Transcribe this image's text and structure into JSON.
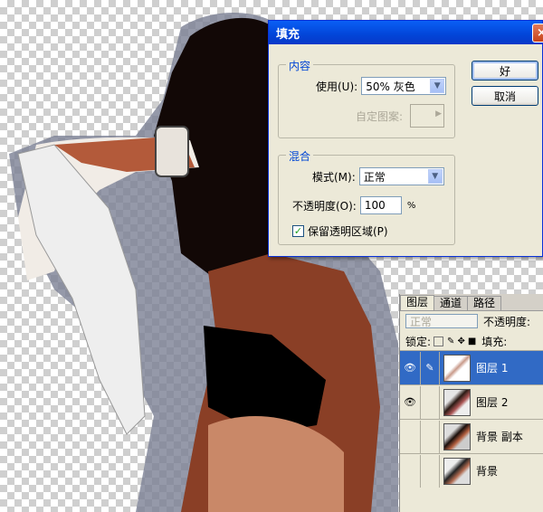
{
  "dialog": {
    "title": "填充",
    "close_glyph": "×",
    "content_group": "内容",
    "use_label": "使用(U):",
    "use_value": "50% 灰色",
    "pattern_label": "自定图案:",
    "blend_group": "混合",
    "mode_label": "模式(M):",
    "mode_value": "正常",
    "opacity_label": "不透明度(O):",
    "opacity_value": "100",
    "opacity_unit": "%",
    "preserve_label": "保留透明区域(P)",
    "preserve_checked": "✓",
    "ok_label": "好",
    "cancel_label": "取消"
  },
  "layers": {
    "tabs": [
      "图层",
      "通道",
      "路径"
    ],
    "blend_mode": "正常",
    "opacity_label": "不透明度:",
    "lock_label": "锁定:",
    "fill_label": "填充:",
    "items": [
      {
        "name": "图层 1",
        "visible": true,
        "selected": true
      },
      {
        "name": "图层 2",
        "visible": true,
        "selected": false
      },
      {
        "name": "背景 副本",
        "visible": false,
        "selected": false
      },
      {
        "name": "背景",
        "visible": false,
        "selected": false
      }
    ],
    "eye_glyph": "👁",
    "brush_glyph": "✎"
  },
  "colors": {
    "accent": "#316ac5",
    "titlebar": "#0245d8",
    "dialog_bg": "#ece9d8"
  }
}
